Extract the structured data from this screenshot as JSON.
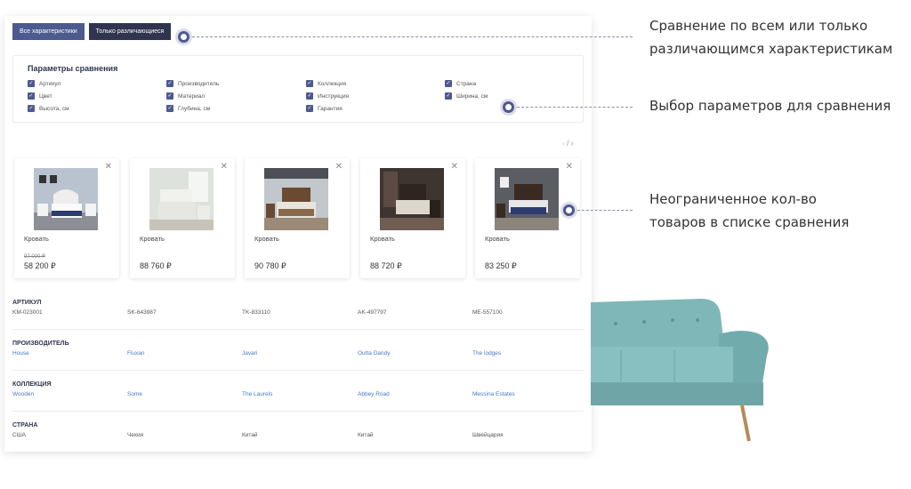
{
  "toggles": {
    "all": "Все характеристики",
    "diff": "Только различающиеся"
  },
  "params": {
    "title": "Параметры сравнения",
    "items": [
      "Артикул",
      "Производитель",
      "Коллекция",
      "Страна",
      "Цвет",
      "Материал",
      "Инструкция",
      "Ширина, см",
      "Высота, см",
      "Глубина, см",
      "Гарантия"
    ]
  },
  "pager": {
    "prev": "‹",
    "sep": "/",
    "next": "›"
  },
  "products": [
    {
      "name": "Кровать",
      "old_price": "97 000 ₽",
      "price": "58 200 ₽"
    },
    {
      "name": "Кровать",
      "old_price": "",
      "price": "88 760 ₽"
    },
    {
      "name": "Кровать",
      "old_price": "",
      "price": "90 780 ₽"
    },
    {
      "name": "Кровать",
      "old_price": "",
      "price": "88 720 ₽"
    },
    {
      "name": "Кровать",
      "old_price": "",
      "price": "83 250 ₽"
    }
  ],
  "specs": [
    {
      "label": "Артикул",
      "values": [
        "KM-023001",
        "SK-643987",
        "TK-833110",
        "AK-497797",
        "ME-557100"
      ],
      "link": false
    },
    {
      "label": "Производитель",
      "values": [
        "House",
        "Fluxan",
        "Javari",
        "Outta Dandy",
        "The lodges"
      ],
      "link": true
    },
    {
      "label": "Коллекция",
      "values": [
        "Wooden",
        "Some",
        "The Laurels",
        "Abbey Road",
        "Messina Estates"
      ],
      "link": true
    },
    {
      "label": "Страна",
      "values": [
        "США",
        "Чехия",
        "Китай",
        "Китай",
        "Швейцария"
      ],
      "link": false
    }
  ],
  "callouts": {
    "c1_line1": "Сравнение по всем или только",
    "c1_line2": "различающимся характеристикам",
    "c2": "Выбор параметров для сравнения",
    "c3_line1": "Неограниченное кол-во",
    "c3_line2": "товаров в списке сравнения"
  },
  "colors": {
    "accent": "#4d5a8f",
    "dark": "#2f3550",
    "link": "#4a78c8",
    "sofa": "#7fb7b8"
  }
}
